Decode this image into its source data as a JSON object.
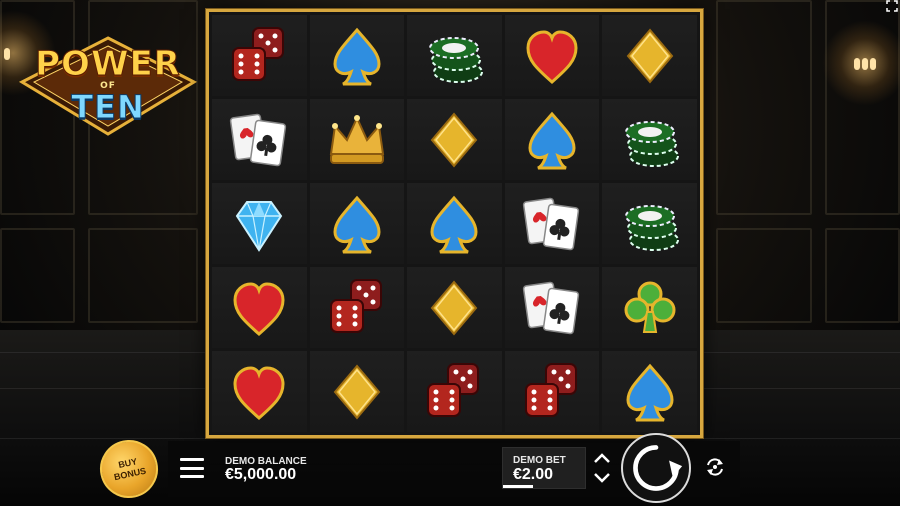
{
  "game": {
    "logo_line1": "POWER",
    "logo_line2": "OF",
    "logo_line3": "TEN"
  },
  "reels": [
    [
      "dice",
      "spade",
      "chips",
      "heart",
      "diamond"
    ],
    [
      "cards",
      "crown",
      "diamond",
      "spade",
      "chips"
    ],
    [
      "gem",
      "spade",
      "spade",
      "cards",
      "chips"
    ],
    [
      "heart",
      "dice",
      "diamond",
      "cards",
      "club"
    ],
    [
      "heart",
      "diamond",
      "dice",
      "dice",
      "spade"
    ]
  ],
  "controls": {
    "buy_bonus_line1": "BUY",
    "buy_bonus_line2": "BONUS",
    "balance_label": "DEMO BALANCE",
    "balance_value": "€5,000.00",
    "bet_label": "DEMO BET",
    "bet_value": "€2.00"
  },
  "colors": {
    "frame_gold": "#d7a73f",
    "spade_blue": "#2f8ee0",
    "heart_red": "#d8252a",
    "club_green": "#4caf3a",
    "diamond_gold": "#e6b52c"
  },
  "icons": [
    "menu-icon",
    "bet-up-icon",
    "bet-down-icon",
    "spin-icon",
    "autoplay-icon",
    "fullscreen-icon"
  ]
}
